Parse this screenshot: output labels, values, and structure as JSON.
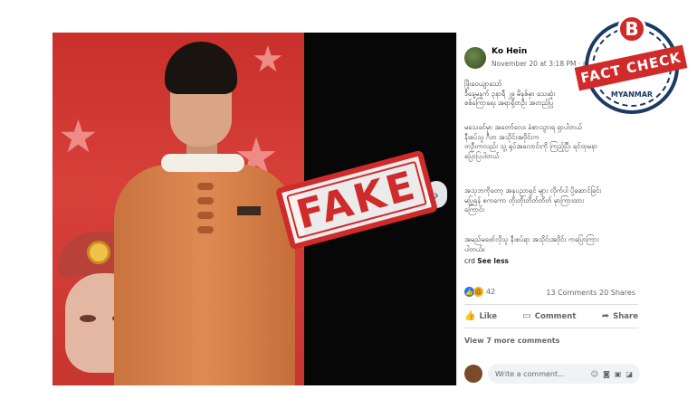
{
  "post": {
    "author": "Ko Hein",
    "timestamp": "November 20 at 3:18 PM · ",
    "globe_icon": "globe-icon",
    "paragraphs": [
      "ဖြိုးဝေယျာသော်\nဒီနေ့မနက် ၃နာရီ ၂၉ မိနစ်မှာ သေဆုံး\nစစ်ကြောရေး အရာရှိတဦး အတည်ပြု",
      "မသေခင်မှာ အတော်လေး ခံစားသွားရ ရှာပါတယ်\nနီးစပ်သူ ဂီတ အသိုင်းအဝိုင်းက\nတဦးကလည်း သူ့ ရုပ်အလောင်းကို ကြည့်ပြီး ရင်ထုမနာ\nပြောပြပါတယ်",
      "အသုဘကိုတော့ အနုပညာရှင် များ လိုက်ပါ ပို့ဆောင်ခြင်း\nမပြုရန် စကကော တိုးတိုးတိတ်တိတ် မှာကြားထား\nကြောင်း",
      "အမည်မဖော်လိုသူ နီးစပ်ရာ အသိုင်းအဝိုင်း ကပြောကြား\nပါတယ်။"
    ],
    "crd_label": "crd",
    "see_less": "See less",
    "reaction_count": "42",
    "comments_count": "13 Comments",
    "shares_count": "20 Shares",
    "actions": {
      "like": "Like",
      "comment": "Comment",
      "share": "Share"
    },
    "view_more_comments": "View 7 more comments",
    "comment_placeholder": "Write a comment..."
  },
  "stamp": {
    "fake_label": "FAKE"
  },
  "badge": {
    "letter": "B",
    "title": "FACT CHECK",
    "subtitle": "MYANMAR"
  },
  "colors": {
    "stamp_red": "#d02a2a",
    "badge_navy": "#1b3a64",
    "fb_blue": "#1877f2"
  }
}
